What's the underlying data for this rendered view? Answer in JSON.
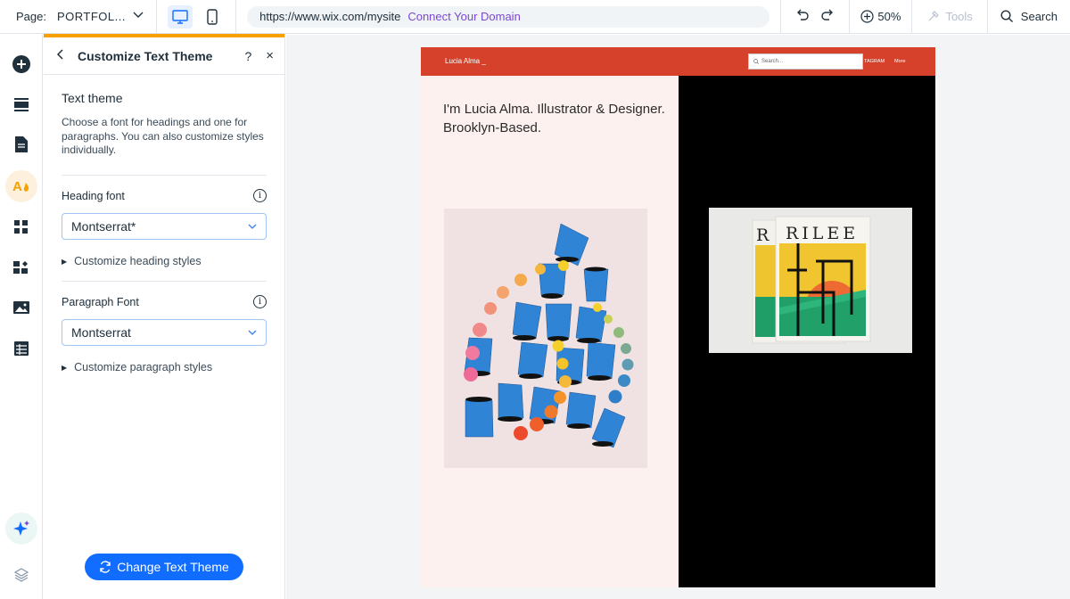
{
  "topbar": {
    "page_label": "Page:",
    "page_value": "PORTFOL...",
    "url": "https://www.wix.com/mysite",
    "connect_domain": "Connect Your Domain",
    "zoom": "50%",
    "tools": "Tools",
    "search": "Search"
  },
  "rail": {
    "items": [
      "add-icon",
      "sections-icon",
      "pages-icon",
      "theme-icon",
      "apps-icon",
      "extensions-icon",
      "media-icon",
      "cms-icon",
      "ai-icon",
      "layers-icon"
    ]
  },
  "panel": {
    "title": "Customize Text Theme",
    "help": "?",
    "close": "×",
    "section_title": "Text theme",
    "section_desc": "Choose a font for headings and one for paragraphs. You can also customize styles individually.",
    "heading_font_label": "Heading font",
    "heading_font_value": "Montserrat*",
    "customize_heading": "Customize heading styles",
    "paragraph_font_label": "Paragraph Font",
    "paragraph_font_value": "Montserrat",
    "customize_paragraph": "Customize paragraph styles",
    "cta": "Change Text Theme"
  },
  "site": {
    "name": "Lucia Alma _",
    "search_placeholder": "Search...",
    "nav_a": "TAGRAM",
    "nav_b": "More",
    "intro": "I'm Lucia Alma. Illustrator & Designer. Brooklyn-Based.",
    "book_title": "RILEE",
    "book_title_back": "R"
  },
  "colors": {
    "accent": "#116dff",
    "panel_accent": "#f6a100",
    "site_header": "#d5412a",
    "domain_link": "#7a49d1"
  }
}
